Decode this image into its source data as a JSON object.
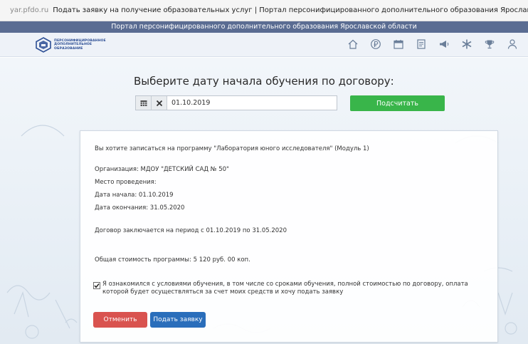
{
  "browser": {
    "lock_icon": "lock-icon",
    "domain": "yar.pfdo.ru",
    "title": "Подать заявку на получение образовательных услуг | Портал персонифицированного дополнительного образования Ярославской области"
  },
  "portal": {
    "strip_title": "Портал персонифицированного дополнительного образования Ярославской области",
    "logo_line1": "ПЕРСОНИФИЦИРОВАННОЕ",
    "logo_line2": "ДОПОЛНИТЕЛЬНОЕ",
    "logo_line3": "ОБРАЗОВАНИЕ",
    "colors": {
      "strip": "#5a6c92",
      "accent_green": "#39b54a",
      "cancel_red": "#d9534f",
      "submit_blue": "#2a6ebb"
    }
  },
  "nav": {
    "icons": [
      "home-icon",
      "ruble-icon",
      "calendar-icon",
      "document-icon",
      "megaphone-icon",
      "star-icon",
      "trophy-icon",
      "user-icon"
    ]
  },
  "date_picker": {
    "title": "Выберите дату начала обучения по договору:",
    "value": "01.10.2019",
    "calc_button": "Подсчитать"
  },
  "card": {
    "program_line": "Вы хотите записаться на программу \"Лаборатория юного исследователя\" (Модуль 1)",
    "organization": "Организация: МДОУ \"ДЕТСКИЙ САД № 50\"",
    "place": "Место проведения:",
    "start_date": "Дата начала: 01.10.2019",
    "end_date": "Дата окончания: 31.05.2020",
    "contract_period": "Договор заключается на период с 01.10.2019 по 31.05.2020",
    "total_cost": "Общая стоимость программы: 5 120 руб. 00 коп.",
    "agree_checked": true,
    "agree_text": "Я ознакомился с условиями обучения, в том числе со сроками обучения, полной стоимостью по договору, оплата которой будет осуществляться за счет моих средств и хочу подать заявку",
    "cancel_button": "Отменить",
    "submit_button": "Подать заявку"
  }
}
